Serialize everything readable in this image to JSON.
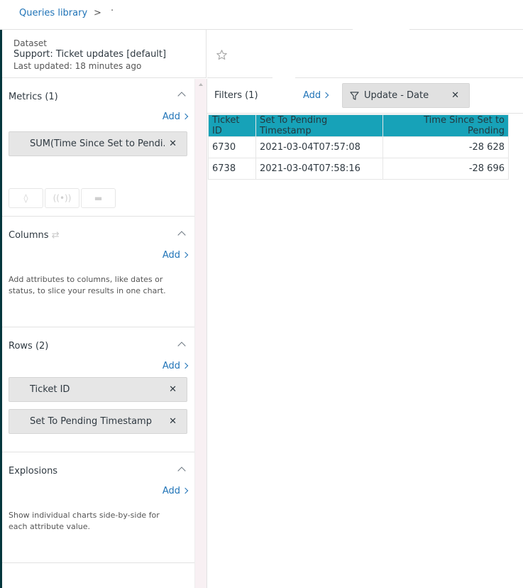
{
  "breadcrumb": {
    "root": "Queries library",
    "separator": ">",
    "current": "·"
  },
  "dataset": {
    "label": "Dataset",
    "name": "Support: Ticket updates [default]",
    "updated": "Last updated: 18 minutes ago"
  },
  "sidebar": {
    "metrics": {
      "title": "Metrics (1)",
      "add": "Add",
      "items": [
        "SUM(Time Since Set to Pendi..."
      ]
    },
    "columns": {
      "title": "Columns",
      "add": "Add",
      "hint": "Add attributes to columns, like dates or status, to slice your results in one chart."
    },
    "rows": {
      "title": "Rows (2)",
      "add": "Add",
      "items": [
        "Ticket ID",
        "Set To Pending Timestamp"
      ]
    },
    "explosions": {
      "title": "Explosions",
      "add": "Add",
      "hint": "Show individual charts side-by-side for each attribute value."
    }
  },
  "filters": {
    "label": "Filters (1)",
    "add": "Add",
    "items": [
      "Update - Date"
    ]
  },
  "table": {
    "headers": [
      "Ticket ID",
      "Set To Pending Timestamp",
      "Time Since Set to Pending"
    ],
    "rows": [
      [
        "6730",
        "2021-03-04T07:57:08",
        "-28 628"
      ],
      [
        "6738",
        "2021-03-04T07:58:16",
        "-28 696"
      ]
    ]
  },
  "colors": {
    "accent": "#1f73b7",
    "header": "#17a2b8",
    "strip": "#03363d"
  }
}
